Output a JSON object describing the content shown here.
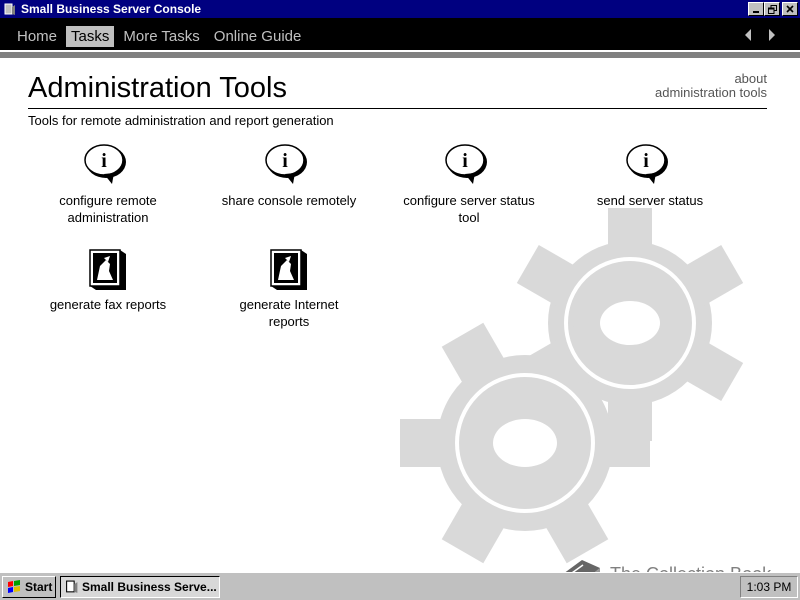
{
  "window": {
    "title": "Small Business Server Console"
  },
  "nav": {
    "tabs": [
      {
        "label": "Home"
      },
      {
        "label": "Tasks"
      },
      {
        "label": "More Tasks"
      },
      {
        "label": "Online Guide"
      }
    ],
    "active_tab": "Tasks"
  },
  "page": {
    "title": "Administration Tools",
    "subtitle": "Tools for remote administration and report generation",
    "about_line1": "about",
    "about_line2": "administration tools"
  },
  "tasks": [
    {
      "label_line1": "configure remote",
      "label_line2": "administration",
      "icon": "info-icon"
    },
    {
      "label_line1": "share console remotely",
      "label_line2": "",
      "icon": "info-icon"
    },
    {
      "label_line1": "configure server status",
      "label_line2": "tool",
      "icon": "info-icon"
    },
    {
      "label_line1": "send server status",
      "label_line2": "",
      "icon": "info-icon"
    },
    {
      "label_line1": "generate fax reports",
      "label_line2": "",
      "icon": "wizard-icon"
    },
    {
      "label_line1": "generate Internet",
      "label_line2": "reports",
      "icon": "wizard-icon"
    }
  ],
  "taskbar": {
    "start_label": "Start",
    "task_button_label": "Small Business Serve...",
    "clock": "1:03 PM"
  },
  "watermark": {
    "text": "The Collection Book"
  },
  "colors": {
    "titlebar": "#000080",
    "navbar": "#000000",
    "active_tab": "#c0c0c0",
    "gears": "#d9d9d9"
  }
}
